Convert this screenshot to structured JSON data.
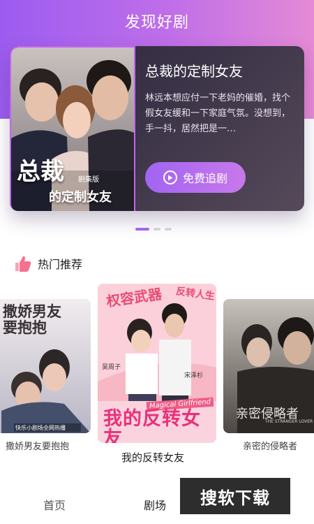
{
  "header": {
    "title": "发现好剧"
  },
  "banner": {
    "poster": {
      "title_big": "总裁",
      "title_sub": "的定制女友",
      "edition": "剧集版"
    },
    "title": "总裁的定制女友",
    "description": "林远本想应付一下老妈的催婚，找个假女友缓和一下家庭气氛。没想到，手一抖，居然把是一…",
    "button_label": "免费追剧"
  },
  "carousel": {
    "count": 3,
    "active_index": 0
  },
  "section": {
    "title": "热门推荐",
    "icon": "thumbs-up-icon"
  },
  "recommendations": [
    {
      "title": "撒娇男友要抱抱",
      "poster_title": "撒娇男友要抱抱",
      "poster_caption": "快乐小剧场全网热播"
    },
    {
      "title": "我的反转女友",
      "poster_title_top": "权容武器",
      "poster_title_mid": "反转人生",
      "poster_title_main": "我的反转女友",
      "poster_subtitle": "Magical Girlfriend",
      "cast": [
        "吴周子",
        "宋泽杉"
      ]
    },
    {
      "title": "亲密的侵略者",
      "poster_title": "亲密侵略者",
      "poster_subtitle": "THE STRANGER LOVER"
    }
  ],
  "nav": {
    "home": "首页",
    "theater": "剧场"
  },
  "watermark": "搜软下载",
  "colors": {
    "accent": "#a264f2",
    "gradient_end": "#e58ad6"
  }
}
